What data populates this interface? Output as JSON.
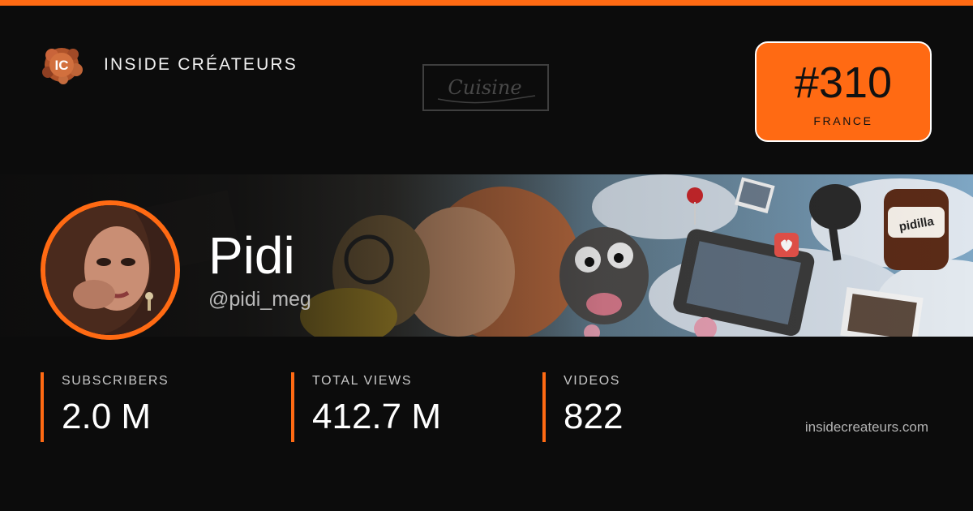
{
  "brand": {
    "name": "INSIDE CRÉATEURS",
    "logo_text": "IC",
    "watermark_text": "Cuisine"
  },
  "rank": {
    "value": "#310",
    "country": "FRANCE"
  },
  "creator": {
    "name": "Pidi",
    "handle": "@pidi_meg",
    "banner_jar_label": "pidilla"
  },
  "stats": [
    {
      "label": "SUBSCRIBERS",
      "value": "2.0 M"
    },
    {
      "label": "TOTAL  VIEWS",
      "value": "412.7 M"
    },
    {
      "label": "VIDEOS",
      "value": "822"
    }
  ],
  "footer": {
    "url": "insidecreateurs.com"
  },
  "colors": {
    "accent": "#ff6a13",
    "background": "#0c0c0c",
    "text": "#ffffff",
    "muted_text": "#b9b9b9"
  },
  "icons": {
    "brand_logo": "ic-logo-icon",
    "avatar": "creator-avatar-photo"
  }
}
